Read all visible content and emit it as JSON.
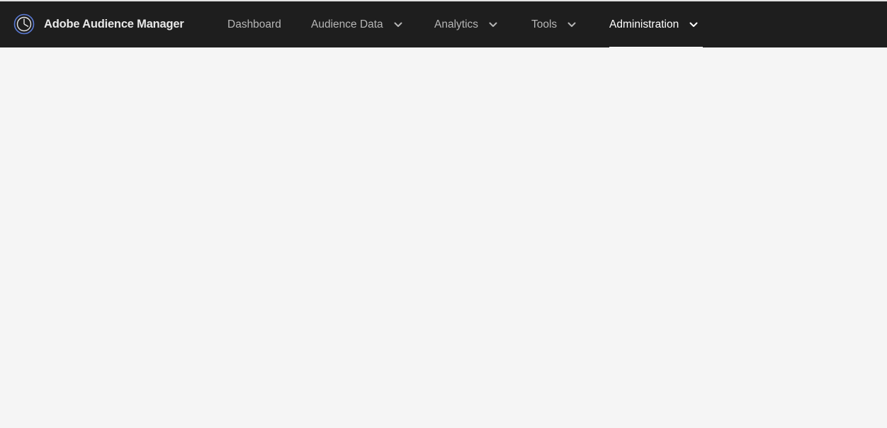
{
  "app": {
    "name": "Adobe Audience Manager",
    "logo_icon": "audience-manager-logo-icon"
  },
  "nav": {
    "items": [
      {
        "label": "Dashboard",
        "has_dropdown": false,
        "active": false
      },
      {
        "label": "Audience Data",
        "has_dropdown": true,
        "active": false
      },
      {
        "label": "Analytics",
        "has_dropdown": true,
        "active": false
      },
      {
        "label": "Tools",
        "has_dropdown": true,
        "active": false
      },
      {
        "label": "Administration",
        "has_dropdown": true,
        "active": true
      }
    ],
    "dropdown_icon": "chevron-down-icon"
  },
  "colors": {
    "topbar_bg": "#1e1e1e",
    "nav_text": "#b6b6b6",
    "nav_active_text": "#ffffff",
    "content_bg": "#f5f5f5",
    "logo_accent": "#5b7bd6"
  }
}
